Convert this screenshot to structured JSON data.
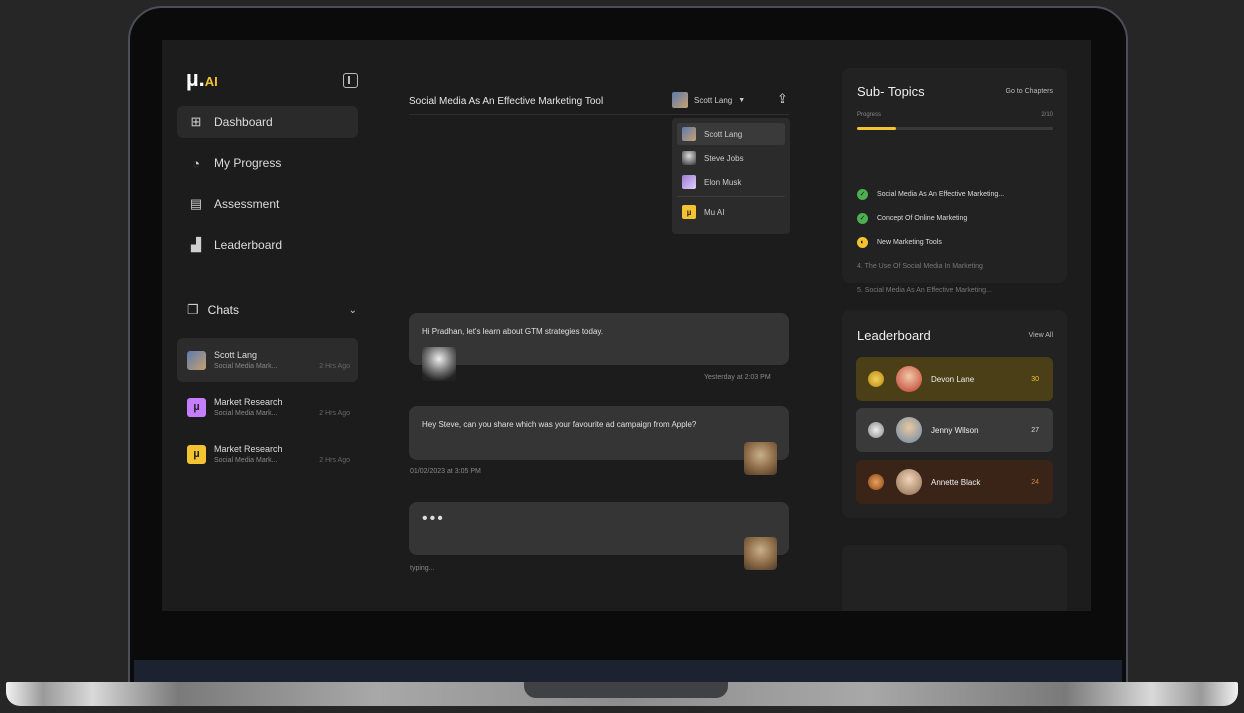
{
  "sidebar": {
    "logo_main": "µ.",
    "logo_suffix": "AI",
    "nav": [
      {
        "label": "Dashboard",
        "icon": "grid-icon"
      },
      {
        "label": "My Progress",
        "icon": "progress-icon"
      },
      {
        "label": "Assessment",
        "icon": "clipboard-icon"
      },
      {
        "label": "Leaderboard",
        "icon": "podium-icon"
      }
    ],
    "chats_label": "Chats",
    "chats": [
      {
        "name": "Scott Lang",
        "sub": "Social Media Mark...",
        "time": "2 Hrs Ago",
        "avatar_color": "#5b7bb0",
        "avatar_letter": ""
      },
      {
        "name": "Market Research",
        "sub": "Social Media Mark...",
        "time": "2 Hrs Ago",
        "avatar_color": "#c77dff",
        "avatar_letter": "µ"
      },
      {
        "name": "Market Research",
        "sub": "Social Media Mark...",
        "time": "2 Hrs Ago",
        "avatar_color": "#f4c430",
        "avatar_letter": "µ"
      }
    ]
  },
  "header": {
    "topic": "Social Media As An Effective Marketing Tool",
    "current_user": "Scott Lang",
    "dropdown": [
      {
        "name": "Scott Lang",
        "avatar_color": "#5b7bb0",
        "letter": ""
      },
      {
        "name": "Steve Jobs",
        "avatar_color": "#555555",
        "letter": ""
      },
      {
        "name": "Elon Musk",
        "avatar_color": "#6a5a9a",
        "letter": ""
      },
      {
        "name": "Mu AI",
        "avatar_color": "#f4c430",
        "letter": "µ"
      }
    ]
  },
  "messages": [
    {
      "text": "Hi Pradhan, let's learn about GTM strategies today.",
      "meta": "Yesterday at 2:03 PM"
    },
    {
      "text": "Hey Steve, can you share which was your favourite ad campaign from Apple?",
      "meta": "01/02/2023 at 3:05 PM"
    },
    {
      "text": "•••",
      "meta": "typing..."
    }
  ],
  "subtopics": {
    "title": "Sub- Topics",
    "link": "Go to Chapters",
    "progress_label": "Progress",
    "progress_text": "2/10",
    "progress_fraction": 0.2,
    "items": [
      {
        "text": "Social Media As An Effective Marketing...",
        "state": "done"
      },
      {
        "text": "Concept Of Online Marketing",
        "state": "done"
      },
      {
        "text": "New Marketing Tools",
        "state": "current"
      },
      {
        "text": "4. The Use Of Social Media In Marketing",
        "state": "todo"
      },
      {
        "text": "5. Social Media As An Effective Marketing...",
        "state": "todo"
      }
    ]
  },
  "leaderboard": {
    "title": "Leaderboard",
    "link": "View All",
    "rows": [
      {
        "name": "Devon Lane",
        "score": "30",
        "bg": "#4a3f17",
        "medal": "#d4a62a",
        "score_color": "#f4c430"
      },
      {
        "name": "Jenny Wilson",
        "score": "27",
        "bg": "#3a3a3a",
        "medal": "#b5b5b5",
        "score_color": "#dddddd"
      },
      {
        "name": "Annette Black",
        "score": "24",
        "bg": "#3a2418",
        "medal": "#c8743a",
        "score_color": "#e0823c"
      }
    ]
  }
}
